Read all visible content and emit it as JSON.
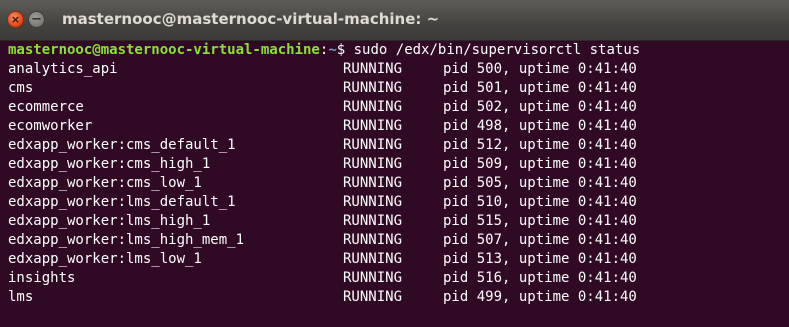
{
  "window": {
    "title": "masternooc@masternooc-virtual-machine: ~"
  },
  "icons": {
    "close": "close-icon",
    "minimize": "minimize-icon"
  },
  "colors": {
    "background": "#300a24",
    "prompt_user": "#8ae234",
    "prompt_path": "#729fcf",
    "text": "#ffffff"
  },
  "terminal": {
    "prompt": {
      "user_host": "masternooc@masternooc-virtual-machine",
      "separator": ":",
      "path": "~",
      "symbol": "$",
      "command": " sudo /edx/bin/supervisorctl status"
    },
    "processes": [
      {
        "name": "analytics_api",
        "state": "RUNNING",
        "info": "pid 500, uptime 0:41:40"
      },
      {
        "name": "cms",
        "state": "RUNNING",
        "info": "pid 501, uptime 0:41:40"
      },
      {
        "name": "ecommerce",
        "state": "RUNNING",
        "info": "pid 502, uptime 0:41:40"
      },
      {
        "name": "ecomworker",
        "state": "RUNNING",
        "info": "pid 498, uptime 0:41:40"
      },
      {
        "name": "edxapp_worker:cms_default_1",
        "state": "RUNNING",
        "info": "pid 512, uptime 0:41:40"
      },
      {
        "name": "edxapp_worker:cms_high_1",
        "state": "RUNNING",
        "info": "pid 509, uptime 0:41:40"
      },
      {
        "name": "edxapp_worker:cms_low_1",
        "state": "RUNNING",
        "info": "pid 505, uptime 0:41:40"
      },
      {
        "name": "edxapp_worker:lms_default_1",
        "state": "RUNNING",
        "info": "pid 510, uptime 0:41:40"
      },
      {
        "name": "edxapp_worker:lms_high_1",
        "state": "RUNNING",
        "info": "pid 515, uptime 0:41:40"
      },
      {
        "name": "edxapp_worker:lms_high_mem_1",
        "state": "RUNNING",
        "info": "pid 507, uptime 0:41:40"
      },
      {
        "name": "edxapp_worker:lms_low_1",
        "state": "RUNNING",
        "info": "pid 513, uptime 0:41:40"
      },
      {
        "name": "insights",
        "state": "RUNNING",
        "info": "pid 516, uptime 0:41:40"
      },
      {
        "name": "lms",
        "state": "RUNNING",
        "info": "pid 499, uptime 0:41:40"
      }
    ]
  }
}
